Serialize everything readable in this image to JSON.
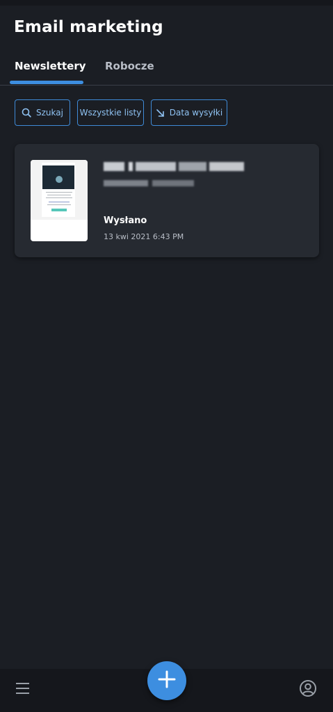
{
  "header": {
    "title": "Email marketing"
  },
  "tabs": [
    {
      "label": "Newslettery",
      "active": true
    },
    {
      "label": "Robocze",
      "active": false
    }
  ],
  "filters": {
    "search_label": "Szukaj",
    "lists_label": "Wszystkie listy",
    "sort_label": "Data wysyłki"
  },
  "newsletter": {
    "status": "Wysłano",
    "date": "13 kwi 2021 6:43 PM"
  },
  "colors": {
    "background": "#1b1e24",
    "card": "#262a31",
    "accent": "#3d8ee0",
    "chip_text": "#8fc2f2"
  },
  "icons": {
    "search": "search-icon",
    "sort": "arrow-down-right-icon",
    "menu": "hamburger-menu-icon",
    "add": "plus-icon",
    "profile": "account-circle-icon"
  }
}
